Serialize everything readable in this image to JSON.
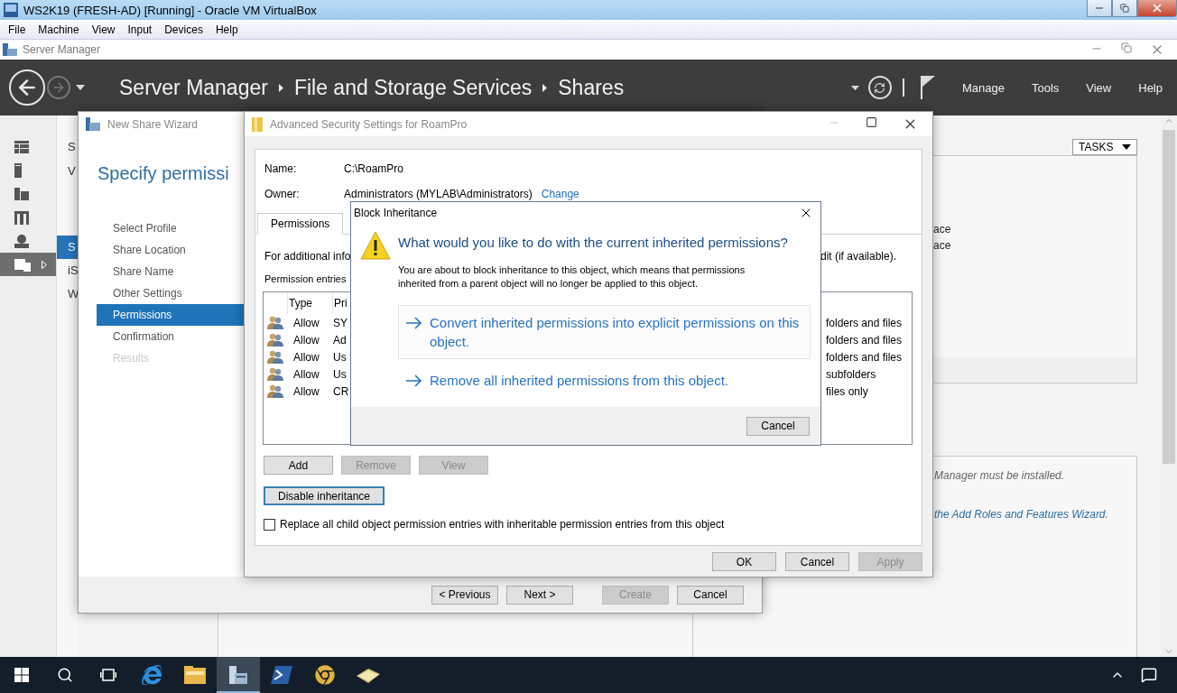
{
  "vm_window": {
    "title": "WS2K19 (FRESH-AD) [Running] - Oracle VM VirtualBox",
    "menu": [
      "File",
      "Machine",
      "View",
      "Input",
      "Devices",
      "Help"
    ]
  },
  "server_manager": {
    "title": "Server Manager",
    "breadcrumb": [
      "Server Manager",
      "File and Storage Services",
      "Shares"
    ],
    "menu": [
      "Manage",
      "Tools",
      "View",
      "Help"
    ],
    "sidebar": [
      {
        "kind": "dashboard",
        "selected": false
      },
      {
        "kind": "server",
        "selected": false
      },
      {
        "kind": "servers",
        "selected": false
      },
      {
        "kind": "roles",
        "selected": false
      },
      {
        "kind": "remote",
        "selected": false
      },
      {
        "kind": "files",
        "selected": true
      }
    ],
    "nav": {
      "title": "S",
      "subtitle": "V",
      "items": [
        {
          "label": "S",
          "selected": true
        },
        {
          "label": "iS",
          "selected": false
        },
        {
          "label": "W",
          "selected": false
        }
      ]
    },
    "tasks_button": "TASKS",
    "top_panel_lines": [
      "ace",
      "ace"
    ],
    "bottom_panel": {
      "note": "Manager must be installed.",
      "link": "the Add Roles and Features Wizard."
    }
  },
  "wizard": {
    "title": "New Share Wizard",
    "heading": "Specify permissi",
    "steps": [
      {
        "label": "Select Profile",
        "selected": false,
        "disabled": false
      },
      {
        "label": "Share Location",
        "selected": false,
        "disabled": false
      },
      {
        "label": "Share Name",
        "selected": false,
        "disabled": false
      },
      {
        "label": "Other Settings",
        "selected": false,
        "disabled": false
      },
      {
        "label": "Permissions",
        "selected": true,
        "disabled": false
      },
      {
        "label": "Confirmation",
        "selected": false,
        "disabled": false
      },
      {
        "label": "Results",
        "selected": false,
        "disabled": true
      }
    ],
    "buttons": [
      {
        "label": "< Previous",
        "disabled": false
      },
      {
        "label": "Next >",
        "disabled": false
      },
      {
        "label": "Create",
        "disabled": true
      },
      {
        "label": "Cancel",
        "disabled": false
      }
    ]
  },
  "security": {
    "title": "Advanced Security Settings for RoamPro",
    "name_label": "Name:",
    "name": "C:\\RoamPro",
    "owner_label": "Owner:",
    "owner": "Administrators (MYLAB\\Administrators)",
    "change_link": "Change",
    "tabs": [
      {
        "label": "Permissions",
        "selected": true
      }
    ],
    "info_left": "For additional info",
    "info_right": "dit (if available).",
    "entries_label": "Permission entries",
    "columns": [
      "Type",
      "Pri"
    ],
    "rows": [
      {
        "type": "Allow",
        "principal": "SY",
        "applies": "folders and files"
      },
      {
        "type": "Allow",
        "principal": "Ad",
        "applies": "folders and files"
      },
      {
        "type": "Allow",
        "principal": "Us",
        "applies": "folders and files"
      },
      {
        "type": "Allow",
        "principal": "Us",
        "applies": "subfolders"
      },
      {
        "type": "Allow",
        "principal": "CR",
        "applies": "files only"
      }
    ],
    "entry_buttons": [
      {
        "label": "Add",
        "disabled": false
      },
      {
        "label": "Remove",
        "disabled": true
      },
      {
        "label": "View",
        "disabled": true
      }
    ],
    "inheritance_button": {
      "label": "Disable inheritance",
      "focused": true
    },
    "replace_checkbox": {
      "label": "Replace all child object permission entries with inheritable permission entries from this object",
      "checked": false
    },
    "buttons": [
      {
        "label": "OK",
        "disabled": false
      },
      {
        "label": "Cancel",
        "disabled": false
      },
      {
        "label": "Apply",
        "disabled": true
      }
    ]
  },
  "dialog": {
    "title": "Block Inheritance",
    "heading": "What would you like to do with the current inherited permissions?",
    "message": "You are about to block inheritance to this object, which means that permissions inherited from a parent object will no longer be applied to this object.",
    "options": [
      {
        "label": "Convert inherited permissions into explicit permissions on this object.",
        "hovered": true
      },
      {
        "label": "Remove all inherited permissions from this object.",
        "hovered": false
      }
    ],
    "cancel": "Cancel"
  },
  "taskbar": {
    "apps": [
      {
        "kind": "ie",
        "selected": false
      },
      {
        "kind": "explorer",
        "selected": false
      },
      {
        "kind": "servermanager",
        "selected": true
      },
      {
        "kind": "powershell",
        "selected": false
      },
      {
        "kind": "chrome",
        "selected": false
      },
      {
        "kind": "app",
        "selected": false
      }
    ]
  }
}
